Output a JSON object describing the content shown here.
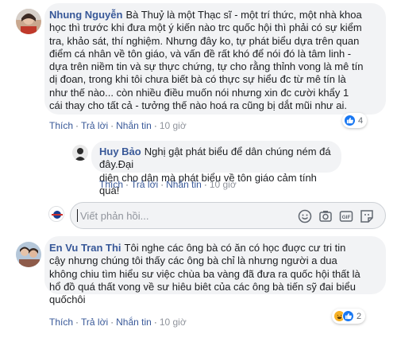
{
  "comments": [
    {
      "author": "Nhung Nguyễn",
      "text_lines": [
        "Bà Thuỷ là một Thạc sĩ - một trí thức, một nhà khoa",
        "học thì trước khi đưa một ý kiến nào trc quốc hội thì phải có sự kiểm",
        "tra, khảo sát, thí nghiệm. Nhưng đây ko, tự phát biểu dựa trên quan",
        "điểm cá nhân về tôn giáo, và vấn đề rất khó để nói đó là tâm linh -",
        "dựa trên niềm tin và sự thực chứng, tự cho rằng thỉnh vong là mê tín",
        "dị đoan, trong khi tôi chưa biết bà có thực sự hiểu đc từ mê tín là",
        "như thế nào... còn nhiều điều muốn nói nhưng xin đc cười khẩy 1",
        "cái thay cho tất cả - tưởng thế nào hoá ra cũng bị dắt mũi như ai."
      ],
      "actions": [
        "Thích",
        "Trả lời",
        "Nhắn tin"
      ],
      "time": "10 giờ",
      "reaction_count": "4"
    },
    {
      "author": "Huy Bảo",
      "text_lines": [
        "Nghị gật phát biểu để dân chúng ném đá đây.Đại",
        "diện cho dân mà phát biểu về tôn giáo cảm tính quá!"
      ],
      "actions": [
        "Thích",
        "Trả lời",
        "Nhắn tin"
      ],
      "time": "10 giờ"
    },
    {
      "author": "En Vu Tran Thi",
      "text_lines": [
        "Tôi nghe các ông bà có ăn có học đuợc cư tri tin",
        "cậy nhưng chúng tôi thấy các ông bà chỉ là nhưng người a dua",
        "không chiu tìm hiểu sư việc chùa ba vàng đã đưa ra quốc hội thất là",
        "hổ đồ quá thất vong về sư hiêu biêt của các ông bà tiến sỹ đai biểu",
        "quốchôi"
      ],
      "actions": [
        "Thích",
        "Trả lời",
        "Nhắn tin"
      ],
      "time": "10 giờ",
      "reaction_count": "2"
    }
  ],
  "reply_input": {
    "placeholder": "Viết phản hồi...",
    "tools": [
      "emoji-icon",
      "camera-icon",
      "gif-icon",
      "sticker-icon"
    ]
  },
  "colors": {
    "author": "#385898",
    "bubble": "#f2f3f5",
    "like_blue": "#1877f2",
    "haha_yellow": "#f7b125"
  }
}
